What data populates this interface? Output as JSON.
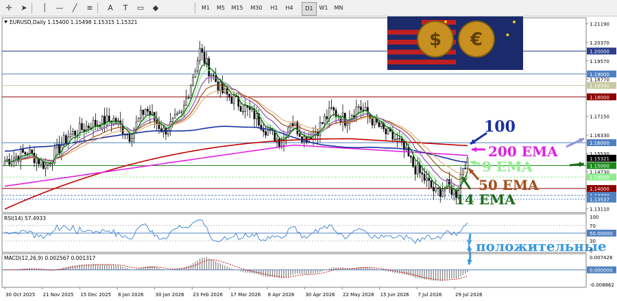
{
  "toolbar": {
    "timeframes": [
      "M1",
      "M5",
      "M15",
      "M30",
      "H1",
      "H4",
      "D1",
      "W1",
      "MN"
    ],
    "tools": [
      "crosshair-icon",
      "cursor-icon",
      "vertical-line-icon",
      "horizontal-line-icon",
      "trendline-icon",
      "fibonacci-icon",
      "text-icon",
      "label-icon",
      "rectangle-icon",
      "shapes-icon"
    ]
  },
  "header": {
    "symbol_text": "EURUSD,Daily  1.15400 1.15498 1.15315 1.15321",
    "rsi_label": "RSI(14) 57.4933",
    "macd_label": "MACD(12,26,9) 0.002567 0.001317"
  },
  "price_axis": {
    "ticks": [
      "1.21190",
      "1.20370",
      "1.19570",
      "1.18770",
      "1.17950",
      "1.17150",
      "1.16330",
      "1.15530",
      "1.14730",
      "1.13910",
      "1.13110"
    ],
    "tick_values": [
      1.2119,
      1.2037,
      1.1957,
      1.1877,
      1.1795,
      1.1715,
      1.1633,
      1.1553,
      1.1473,
      1.1391,
      1.1311
    ],
    "ylim": [
      1.1295,
      1.2145
    ],
    "level_labels": [
      {
        "text": "1.20000",
        "value": 1.2,
        "bg": "#2c3e8c",
        "fg": "#ffffff"
      },
      {
        "text": "1.19000",
        "value": 1.19,
        "bg": "#5080c0",
        "fg": "#ffffff"
      },
      {
        "text": "1.18500",
        "value": 1.185,
        "bg": "#c8c8a0",
        "fg": "#ffffff"
      },
      {
        "text": "1.18000",
        "value": 1.18,
        "bg": "#8b0000",
        "fg": "#ffffff"
      },
      {
        "text": "1.16000",
        "value": 1.16,
        "bg": "#5080c0",
        "fg": "#ffffff"
      },
      {
        "text": "1.15321",
        "value": 1.15321,
        "bg": "#000000",
        "fg": "#ffffff"
      },
      {
        "text": "1.15000",
        "value": 1.15,
        "bg": "#1a8a1a",
        "fg": "#ffffff"
      },
      {
        "text": "1.14500",
        "value": 1.145,
        "bg": "#90ee90",
        "fg": "#ffffff"
      },
      {
        "text": "1.14000",
        "value": 1.14,
        "bg": "#8b0000",
        "fg": "#ffffff"
      },
      {
        "text": "1.13700",
        "value": 1.137,
        "bg": "#5080c0",
        "fg": "#ffffff"
      },
      {
        "text": "1.13537",
        "value": 1.13537,
        "bg": "#5080c0",
        "fg": "#ffffff"
      }
    ]
  },
  "rsi_axis": {
    "ticks": [
      "100",
      "70",
      "50.00000",
      "30",
      "0"
    ],
    "tick_values": [
      100,
      70,
      50,
      30,
      0
    ]
  },
  "macd_axis": {
    "ticks": [
      "0.007428",
      "0.000000",
      "-0.008862"
    ],
    "tick_values": [
      0.007428,
      0,
      -0.008862
    ]
  },
  "date_axis": [
    "30 Oct 2025",
    "21 Nov 2025",
    "15 Dec 2025",
    "8 Jan 2026",
    "30 Jan 2026",
    "23 Feb 2026",
    "17 Mar 2026",
    "8 Apr 2026",
    "30 Apr 2026",
    "22 May 2026",
    "15 Jun 2026",
    "7 Jul 2026",
    "29 Jul 2026"
  ],
  "annotations": {
    "ma100": "100",
    "ema200": "200 EMA",
    "ema9": "9 EMA",
    "ema50": "50 EMA",
    "ema14": "14 EMA",
    "positive": "положительные"
  },
  "colors": {
    "ma100": "#1a2fa0",
    "ema200": "#e020e0",
    "ema9": "#90ee90",
    "ema50": "#a0501a",
    "ema14": "#1a6b1a",
    "positive": "#3a9ae0",
    "ma200_red": "#c00000",
    "rsi_line": "#3a7fd0",
    "macd_hist": "#808080",
    "macd_signal": "#c00000"
  },
  "thumbnail": {
    "icons": [
      "dollar-coin-icon",
      "euro-coin-icon"
    ],
    "glyphs": [
      "$",
      "€"
    ]
  }
}
